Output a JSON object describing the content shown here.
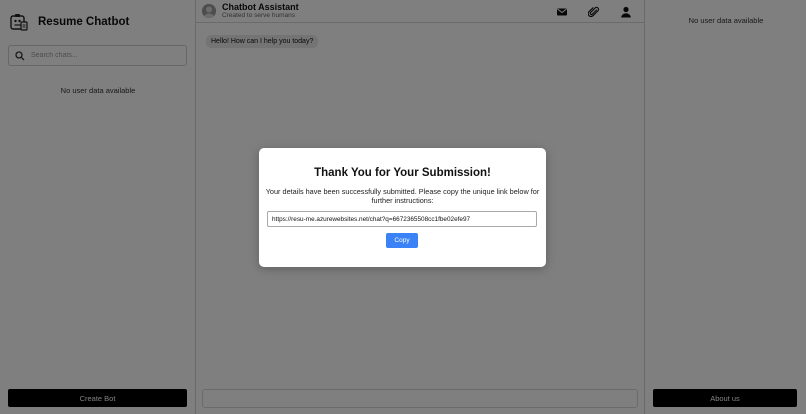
{
  "sidebar": {
    "title": "Resume Chatbot",
    "logo_icon": "robot-document-icon",
    "search_placeholder": "Search chats...",
    "empty_text": "No user data available",
    "create_button": "Create Bot"
  },
  "chat": {
    "title": "Chatbot Assistant",
    "subtitle": "Created to serve humans",
    "icons": [
      "mail-icon",
      "paperclip-icon",
      "user-icon"
    ],
    "messages": [
      {
        "sender": "bot",
        "text": "Hello! How can I help you today?"
      }
    ]
  },
  "right_panel": {
    "empty_text": "No user data available",
    "about_button": "About us"
  },
  "modal": {
    "title": "Thank You for Your Submission!",
    "message": "Your details have been successfully submitted. Please copy the unique link below for further instructions:",
    "link": "https://resu-me.azurewebsites.net/chat?q=6672365508cc1fbe02efe97",
    "copy_button": "Copy"
  },
  "colors": {
    "accent": "#3b82f6",
    "button_dark": "#000000",
    "overlay": "rgba(0,0,0,0.5)"
  }
}
